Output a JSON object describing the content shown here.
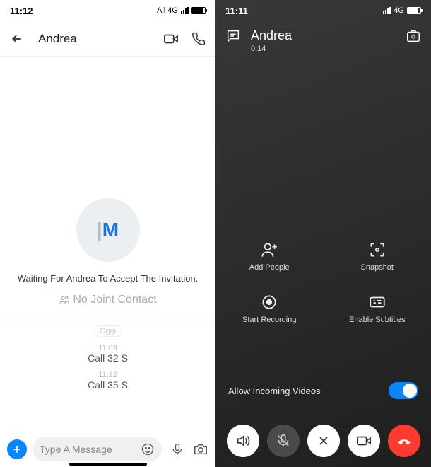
{
  "left": {
    "status": {
      "time": "11:12",
      "net": "All 4G"
    },
    "header": {
      "title": "Andrea"
    },
    "avatar_initials": {
      "bar": "|",
      "m": "M"
    },
    "waiting": "Waiting For Andrea To Accept The Invitation.",
    "nojoint": "No Joint Contact",
    "daylabel": "Oggi",
    "calls": [
      {
        "time": "11:09",
        "desc": "Call 32 S"
      },
      {
        "time": "11:12",
        "desc": "Call 35 S"
      }
    ],
    "input": {
      "placeholder": "Type A Message"
    }
  },
  "right": {
    "status": {
      "time": "11:11",
      "net": "4G"
    },
    "header": {
      "title": "Andrea",
      "duration": "0:14"
    },
    "actions": {
      "add": "Add People",
      "snapshot": "Snapshot",
      "record": "Start Recording",
      "subs": "Enable Subtitles"
    },
    "toggle": {
      "label": "Allow Incoming Videos"
    }
  }
}
